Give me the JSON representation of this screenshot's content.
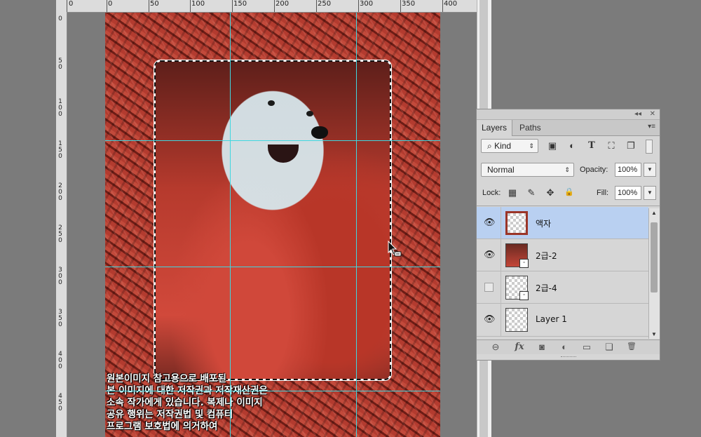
{
  "ruler": {
    "top_labels": [
      "0",
      "0",
      "50",
      "100",
      "150",
      "200",
      "250",
      "300",
      "350",
      "400"
    ],
    "left_labels": [
      "0",
      "5\n0",
      "1\n0\n0",
      "1\n5\n0",
      "2\n0\n0",
      "2\n5\n0",
      "3\n0\n0",
      "3\n5\n0",
      "4\n0\n0",
      "4\n5\n0"
    ]
  },
  "canvas": {
    "caption_lines": [
      "원본이미지 참고용으로 배포된",
      "본 이미지에 대한 저작권과 저작재산권은",
      "소속 작가에게 있습니다. 복제나 이미지",
      "공유 행위는 저작권법 및 컴퓨터",
      "프로그램 보호법에 의거하여"
    ]
  },
  "layers_panel": {
    "collapse_glyph": "◂◂",
    "close_glyph": "✕",
    "tabs": [
      {
        "label": "Layers",
        "active": true
      },
      {
        "label": "Paths",
        "active": false
      }
    ],
    "menu_glyph": "▾≡",
    "filter": {
      "label": "Kind",
      "search_glyph": "⌕"
    },
    "filter_icons": [
      "image-filter-icon",
      "adjustment-filter-icon",
      "type-filter-icon",
      "shape-filter-icon",
      "smart-object-filter-icon"
    ],
    "filter_glyphs": [
      "▣",
      "◐",
      "T",
      "⛶",
      "❐"
    ],
    "blend_mode": "Normal",
    "opacity_label": "Opacity:",
    "opacity_value": "100%",
    "lock_label": "Lock:",
    "lock_glyphs": [
      "▦",
      "✎",
      "✥",
      "🔒"
    ],
    "fill_label": "Fill:",
    "fill_value": "100%",
    "layers": [
      {
        "name": "액자",
        "visible": true,
        "selected": true,
        "thumb": "frame"
      },
      {
        "name": "2급-2",
        "visible": true,
        "selected": false,
        "thumb": "photo"
      },
      {
        "name": "2급-4",
        "visible": false,
        "selected": false,
        "thumb": "photo2"
      },
      {
        "name": "Layer 1",
        "visible": true,
        "selected": false,
        "thumb": "transparent"
      }
    ],
    "bottom_glyphs": [
      "⊖",
      "fx",
      "◙",
      "◐",
      "▭",
      "❏",
      "🗑"
    ]
  },
  "colors": {
    "guide": "#3fd7e0",
    "selected_layer": "#b9d0f1",
    "canvas_bg": "#7b7b7b"
  }
}
